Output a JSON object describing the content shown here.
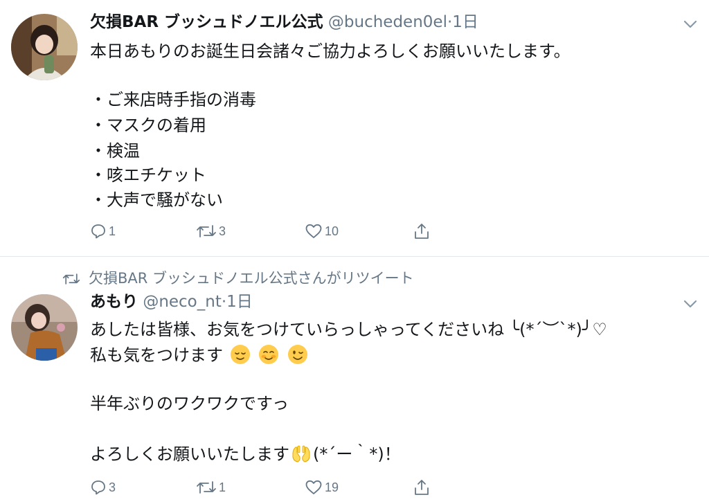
{
  "tweet1": {
    "name": "欠損BAR ブッシュドノエル公式",
    "handle": "@bucheden0el",
    "time": "·1日",
    "lines": [
      "本日あもりのお誕生日会諸々ご協力よろしくお願いいたします。",
      "・ご来店時手指の消毒",
      "・マスクの着用",
      "・検温",
      "・咳エチケット",
      "・大声で騒がない"
    ],
    "actions": {
      "reply": "1",
      "retweet": "3",
      "like": "10"
    }
  },
  "retweet_label": "欠損BAR ブッシュドノエル公式さんがリツイート",
  "tweet2": {
    "name": "あもり",
    "handle": "@neco_nt",
    "time": "·1日",
    "line1": "あしたは皆様、お気をつけていらっしゃってくださいね ╰(*´︶`*)╯♡",
    "line2": "私も気をつけます",
    "line3": "半年ぶりのワクワクですっ",
    "line4a": "よろしくお願いいたします",
    "line4b": "(*´ー｀*)！",
    "emoji_line2": [
      "relieved-face",
      "smiling-face",
      "winking-face"
    ],
    "emoji_line4": "palms-up-together",
    "actions": {
      "reply": "3",
      "retweet": "1",
      "like": "19"
    }
  },
  "colors": {
    "accent": "#1da1f2",
    "text": "#14171a",
    "muted": "#657786",
    "divider": "#e1e8ed"
  }
}
